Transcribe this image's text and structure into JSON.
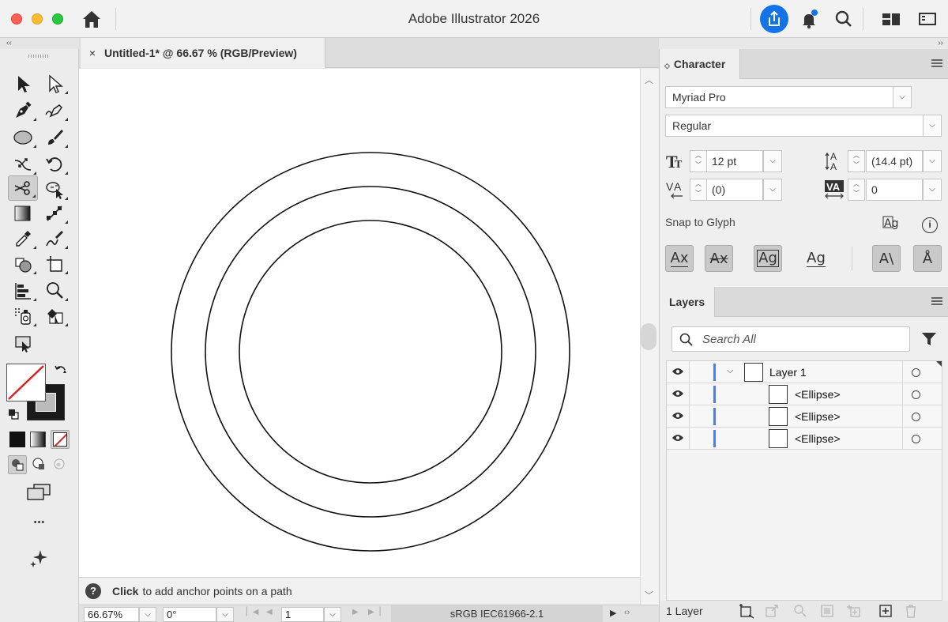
{
  "app": {
    "title": "Adobe Illustrator 2026"
  },
  "document": {
    "tab_label": "Untitled-1* @ 66.67 % (RGB/Preview)",
    "close_glyph": "×"
  },
  "toolbar": {
    "tools": [
      "selection-tool",
      "direct-selection-tool",
      "pen-tool",
      "curvature-tool",
      "ellipse-tool",
      "paintbrush-tool",
      "width-tool",
      "rotate-tool",
      "scissors-tool",
      "shape-builder-tool",
      "gradient-tool",
      "blend-tool",
      "eyedropper-tool",
      "warp-tool",
      "live-paint-tool",
      "artboard-tool",
      "column-graph-tool",
      "zoom-tool",
      "symbol-sprayer-tool",
      "live-paint-selection-tool",
      "perspective-tool"
    ],
    "active_tool": "scissors-tool",
    "fill_color": "#ffffff",
    "stroke_color": "#1a1a1a",
    "more_glyph": "•••"
  },
  "hint": {
    "q": "?",
    "bold": "Click",
    "text": "to add anchor points on a path"
  },
  "statusbar": {
    "zoom": "66.67%",
    "rotation": "0°",
    "artboard": "1",
    "color_profile": "sRGB IEC61966-2.1"
  },
  "character": {
    "title": "Character",
    "font_family": "Myriad Pro",
    "font_style": "Regular",
    "font_size": "12 pt",
    "leading": "(14.4 pt)",
    "kerning": "(0)",
    "tracking": "0",
    "snap_label": "Snap to Glyph",
    "snap_buttons": [
      "Ax",
      "Ax",
      "Ag",
      "Ag",
      "A\\",
      "Å"
    ]
  },
  "layers": {
    "title": "Layers",
    "search_placeholder": "Search All",
    "rows": [
      {
        "name": "Layer 1"
      },
      {
        "name": "<Ellipse>"
      },
      {
        "name": "<Ellipse>"
      },
      {
        "name": "<Ellipse>"
      }
    ],
    "count": "1 Layer"
  },
  "colors": {
    "accent": "#1473e6",
    "layer_color": "#4f7cf2"
  }
}
